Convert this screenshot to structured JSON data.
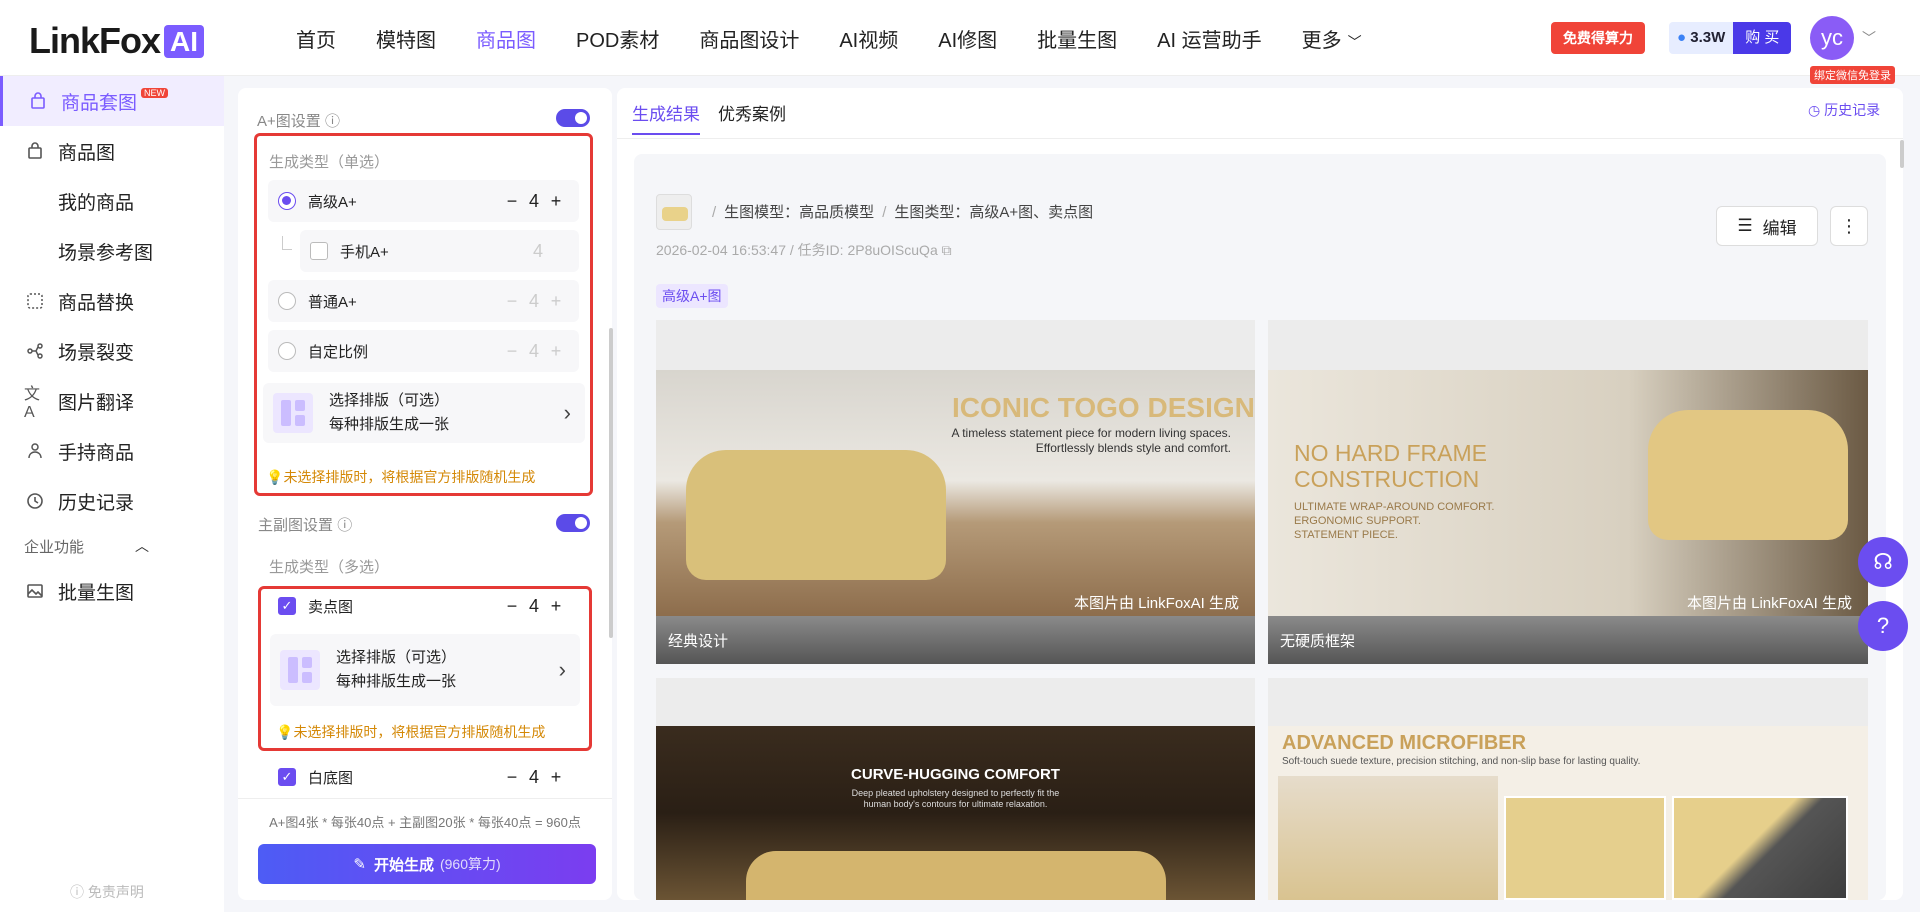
{
  "header": {
    "logo": {
      "text": "LinkFox",
      "badge": "AI"
    },
    "nav": [
      "首页",
      "模特图",
      "商品图",
      "POD素材",
      "商品图设计",
      "AI视频",
      "AI修图",
      "批量生图",
      "AI 运营助手",
      "更多"
    ],
    "nav_active": "商品图",
    "free_power_label": "免费得算力",
    "power_value": "3.3W",
    "buy_label": "购 买",
    "avatar_text": "yc",
    "wechat_tag": "绑定微信免登录"
  },
  "sidebar": {
    "items": [
      {
        "label": "商品套图",
        "badge": "NEW",
        "icon": "bag-icon"
      },
      {
        "label": "商品图",
        "icon": "bag-icon"
      },
      {
        "label": "我的商品"
      },
      {
        "label": "场景参考图"
      },
      {
        "label": "商品替换",
        "icon": "swap-icon"
      },
      {
        "label": "场景裂变",
        "icon": "split-icon"
      },
      {
        "label": "图片翻译",
        "icon": "translate-icon"
      },
      {
        "label": "手持商品",
        "icon": "hand-icon"
      },
      {
        "label": "历史记录",
        "icon": "history-icon"
      }
    ],
    "group_label": "企业功能",
    "group_items": [
      {
        "label": "批量生图",
        "icon": "image-icon"
      }
    ],
    "disclaimer": "免责声明"
  },
  "settings": {
    "aplus_title": "A+图设置",
    "aplus_type_title": "生成类型（单选）",
    "aplus_options": [
      {
        "label": "高级A+",
        "count": "4",
        "selected": true
      },
      {
        "label": "手机A+",
        "count": "4",
        "selected": false
      },
      {
        "label": "普通A+",
        "count": "4",
        "selected": false
      },
      {
        "label": "自定比例",
        "count": "4",
        "selected": false
      }
    ],
    "layout_line1": "选择排版（可选）",
    "layout_line2": "每种排版生成一张",
    "tip": "未选择排版时，将根据官方排版随机生成",
    "main_title": "主副图设置",
    "main_type_title": "生成类型（多选）",
    "main_options": [
      {
        "label": "卖点图",
        "count": "4",
        "checked": true
      },
      {
        "label": "白底图",
        "count": "4",
        "checked": true
      }
    ],
    "cost_text": "A+图4张 * 每张40点 + 主副图20张 * 每张40点 = 960点",
    "generate_label": "开始生成",
    "generate_cost": "(960算力)"
  },
  "main": {
    "tabs": [
      "生成结果",
      "优秀案例"
    ],
    "history_label": "历史记录",
    "model_label": "生图模型：高品质模型",
    "type_label": "生图类型：高级A+图、卖点图",
    "datetime": "2026-02-04 16:53:47",
    "task_id": "任务ID: 2P8uOIScuQa",
    "edit_label": "编辑",
    "section_pill": "高级A+图",
    "watermark": "本图片由 LinkFoxAI 生成",
    "cards": [
      {
        "caption": "经典设计",
        "headline": "ICONIC TOGO DESIGN",
        "body1": "A timeless statement piece for modern living spaces.",
        "body2": "Effortlessly blends style and comfort."
      },
      {
        "caption": "无硬质框架",
        "headline1": "NO HARD FRAME",
        "headline2": "CONSTRUCTION",
        "bullets": [
          "ULTIMATE WRAP-AROUND COMFORT.",
          "ERGONOMIC SUPPORT.",
          "STATEMENT PIECE."
        ]
      },
      {
        "headline": "CURVE-HUGGING COMFORT",
        "body1": "Deep pleated upholstery designed to perfectly fit the",
        "body2": "human body's contours for ultimate relaxation."
      },
      {
        "headline": "ADVANCED MICROFIBER",
        "body1": "Soft-touch suede texture, precision stitching, and non-slip base for lasting quality."
      }
    ]
  }
}
